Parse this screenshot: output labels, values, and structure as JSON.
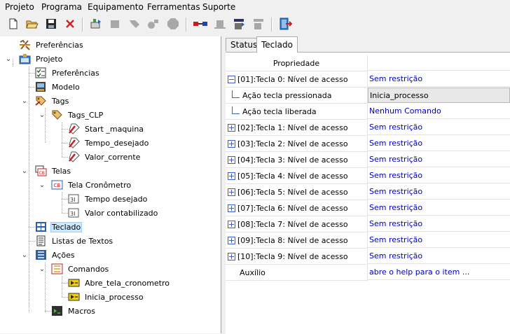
{
  "menu": [
    "Projeto",
    "Programa",
    "Equipamento",
    "Ferramentas",
    "Suporte"
  ],
  "toolbar": {
    "buttons": [
      "new-file-icon",
      "open-folder-icon",
      "save-icon",
      "close-icon",
      "add-device-icon",
      "component-icon",
      "tag-icon",
      "compile-icon",
      "stop-icon",
      "connect-icon",
      "plug-icon",
      "download-icon",
      "upload-icon",
      "exit-icon"
    ]
  },
  "tree": {
    "preferencias_root": "Preferências",
    "projeto": "Projeto",
    "preferencias": "Preferências",
    "modelo": "Modelo",
    "tags": "Tags",
    "tags_clp": "Tags_CLP",
    "start_maquina": "Start _maquina",
    "tempo_desejado": "Tempo_desejado",
    "valor_corrente": "Valor_corrente",
    "telas": "Telas",
    "tela_cronometro": "Tela Cronômetro",
    "tempo_desejado_obj": "Tempo desejado",
    "valor_contabilizado": "Valor contabilizado",
    "teclado": "Teclado",
    "listas_textos": "Listas de Textos",
    "acoes": "Ações",
    "comandos": "Comandos",
    "abre_tela": "Abre_tela_cronometro",
    "inicia_processo": "Inicia_processo",
    "macros": "Macros"
  },
  "tabs": [
    "Status",
    "Teclado"
  ],
  "grid": {
    "header": "Propriedade",
    "rows": [
      {
        "label": "[01]:Tecla 0: Nível de acesso",
        "value": "Sem restrição"
      },
      {
        "label": "Ação tecla pressionada",
        "value": "Inicia_processo"
      },
      {
        "label": "Ação tecla liberada",
        "value": "Nenhum Comando"
      },
      {
        "label": "[02]:Tecla 1: Nível de acesso",
        "value": "Sem restrição"
      },
      {
        "label": "[03]:Tecla 2: Nível de acesso",
        "value": "Sem restrição"
      },
      {
        "label": "[04]:Tecla 3: Nível de acesso",
        "value": "Sem restrição"
      },
      {
        "label": "[05]:Tecla 4: Nível de acesso",
        "value": "Sem restrição"
      },
      {
        "label": "[06]:Tecla 5: Nível de acesso",
        "value": "Sem restrição"
      },
      {
        "label": "[07]:Tecla 6: Nível de acesso",
        "value": "Sem restrição"
      },
      {
        "label": "[08]:Tecla 7: Nível de acesso",
        "value": "Sem restrição"
      },
      {
        "label": "[09]:Tecla 8: Nível de acesso",
        "value": "Sem restrição"
      },
      {
        "label": "[10]:Tecla 9: Nível de acesso",
        "value": "Sem restrição"
      },
      {
        "label": "Auxílio",
        "value": "abre o help para o item ..."
      }
    ]
  },
  "colors": {
    "link": "#0000c0",
    "selection": "#cce8ff",
    "expander": "#3a5fcd"
  }
}
